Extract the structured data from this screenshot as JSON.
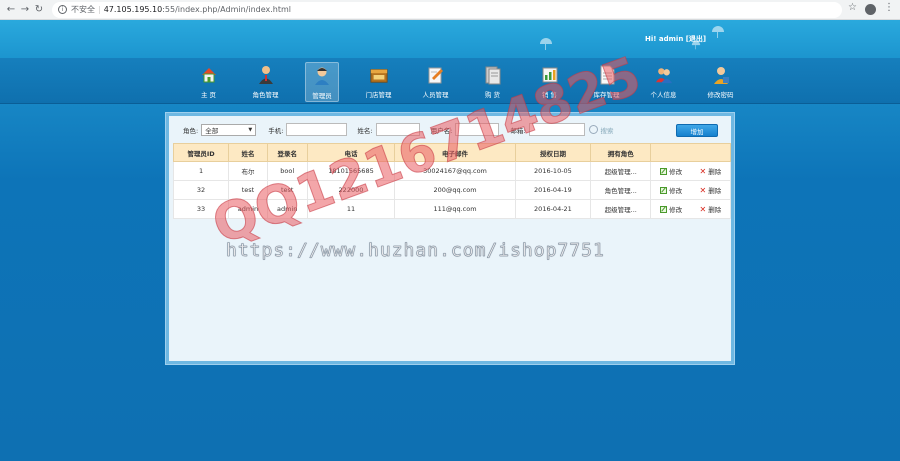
{
  "browser": {
    "insecure_label": "不安全",
    "url_host": "47.105.195.10",
    "url_rest": ":55/index.php/Admin/index.html"
  },
  "header": {
    "greeting": "Hi! admin [退出]"
  },
  "nav": [
    {
      "label": "主  页",
      "icon": "home-icon"
    },
    {
      "label": "角色管理",
      "icon": "role-icon"
    },
    {
      "label": "管理员",
      "icon": "admin-icon"
    },
    {
      "label": "门店管理",
      "icon": "store-icon"
    },
    {
      "label": "人员管理",
      "icon": "staff-icon"
    },
    {
      "label": "购  货",
      "icon": "purchase-icon"
    },
    {
      "label": "销  售",
      "icon": "sales-icon"
    },
    {
      "label": "库存管理",
      "icon": "inventory-icon"
    },
    {
      "label": "个人信息",
      "icon": "profile-icon"
    },
    {
      "label": "修改密码",
      "icon": "password-icon"
    }
  ],
  "filter": {
    "role_label": "角色:",
    "role_value": "全部",
    "phone_label": "手机:",
    "name_label": "姓名:",
    "username_label": "用户名:",
    "email_label": "邮箱:",
    "search_label": "搜索",
    "add_label": "增加"
  },
  "table": {
    "headers": [
      "管理员ID",
      "姓名",
      "登录名",
      "电话",
      "电子邮件",
      "授权日期",
      "拥有角色",
      ""
    ],
    "rows": [
      [
        "1",
        "布尔",
        "bool",
        "18101565685",
        "30024167@qq.com",
        "2016-10-05",
        "超级管理..."
      ],
      [
        "32",
        "test",
        "test",
        "222000",
        "200@qq.com",
        "2016-04-19",
        "角色管理..."
      ],
      [
        "33",
        "admin",
        "admin",
        "11",
        "111@qq.com",
        "2016-04-21",
        "超级管理..."
      ]
    ],
    "edit_label": "修改",
    "delete_label": "删除"
  },
  "watermarks": {
    "url": "https://www.huzhan.com/ishop7751",
    "qq": "QQ1216714825"
  }
}
